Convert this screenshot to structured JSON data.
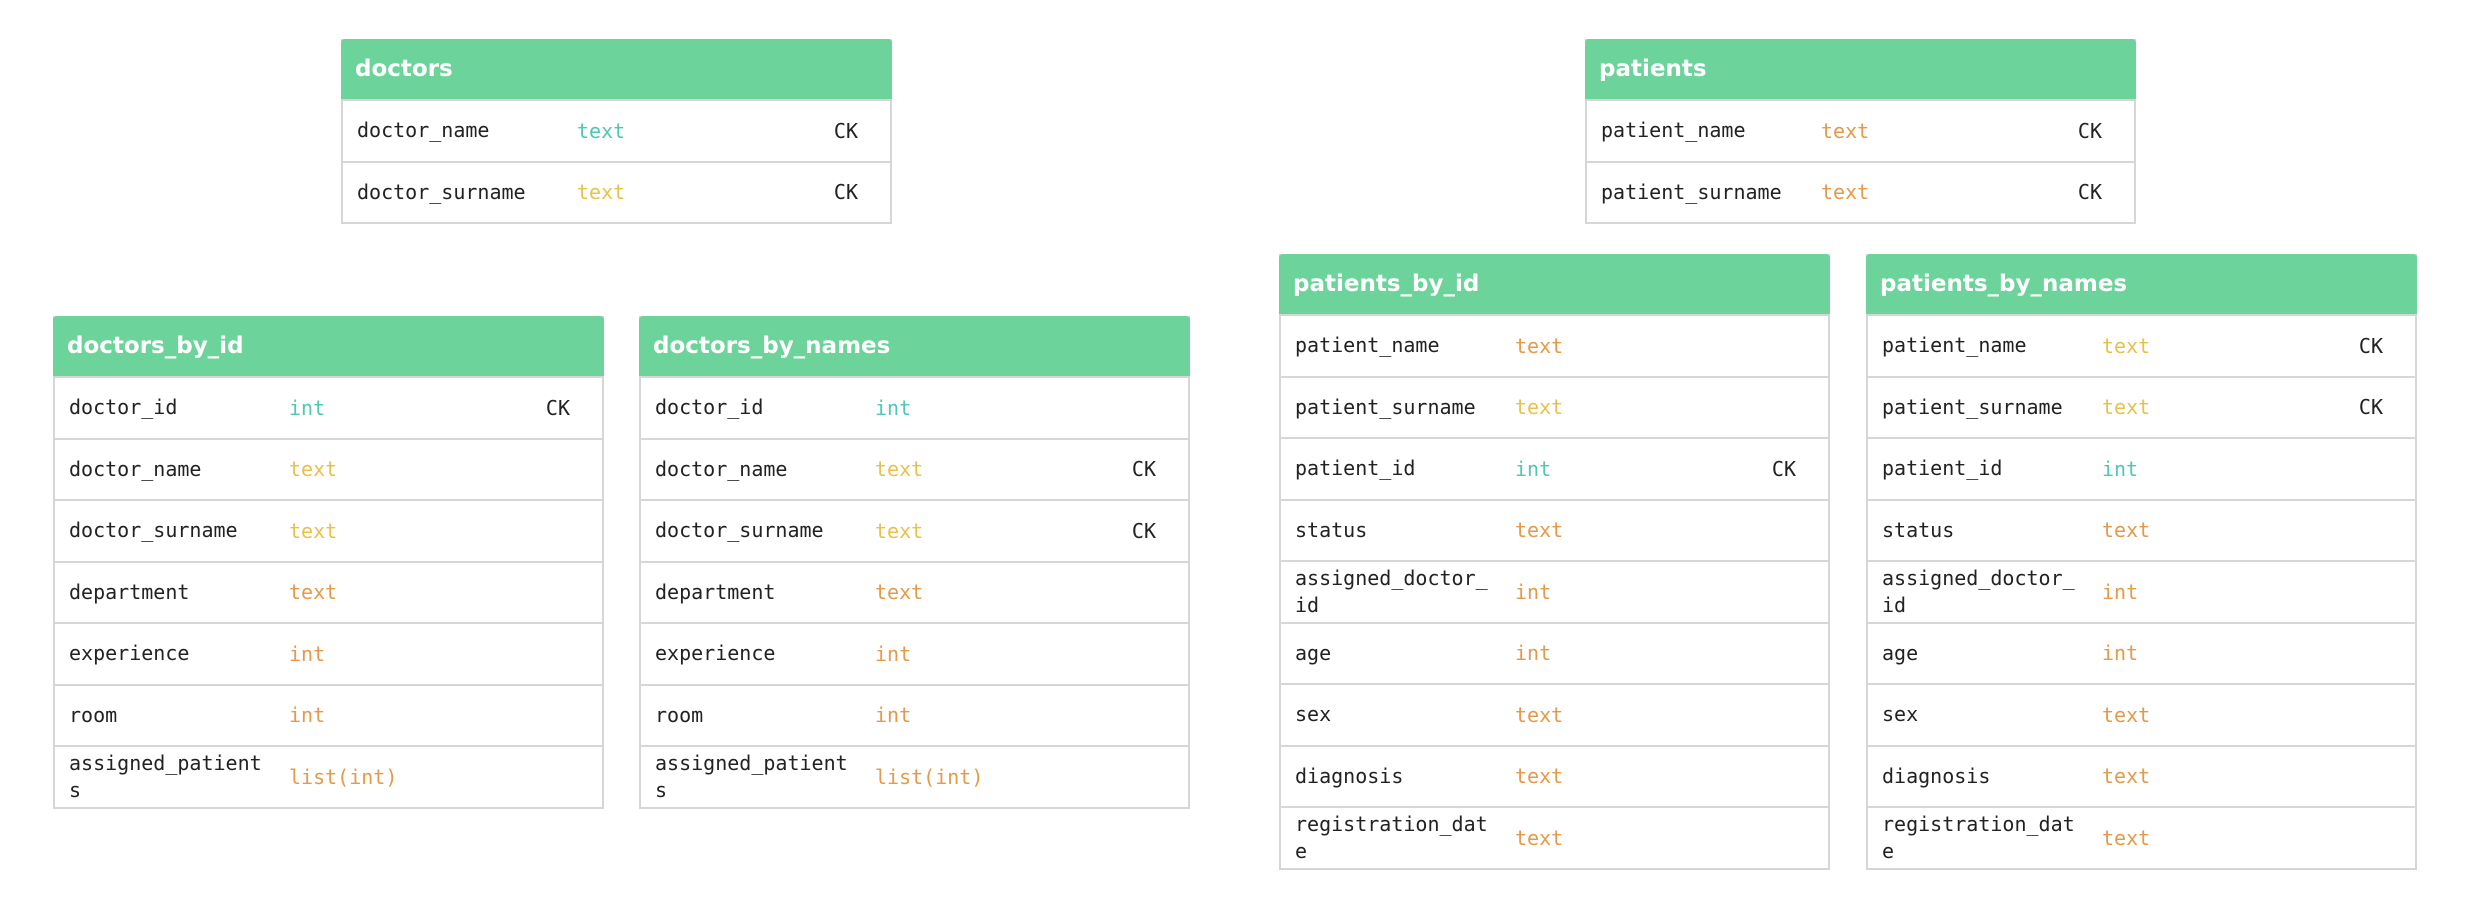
{
  "colors": {
    "header": "#6cd49a",
    "teal": "#4fc7b6",
    "yellow": "#e8c14a",
    "orange": "#e59a4a",
    "border": "#d6d6d6"
  },
  "tables": [
    {
      "id": "doctors",
      "title": "doctors",
      "rows": [
        {
          "name": "doctor_name",
          "type": "text",
          "color": "teal",
          "key": "CK"
        },
        {
          "name": "doctor_surname",
          "type": "text",
          "color": "yellow",
          "key": "CK"
        }
      ]
    },
    {
      "id": "patients",
      "title": "patients",
      "rows": [
        {
          "name": "patient_name",
          "type": "text",
          "color": "orange",
          "key": "CK"
        },
        {
          "name": "patient_surname",
          "type": "text",
          "color": "orange",
          "key": "CK"
        }
      ]
    },
    {
      "id": "doctors_by_id",
      "title": "doctors_by_id",
      "rows": [
        {
          "name": "doctor_id",
          "type": "int",
          "color": "teal",
          "key": "CK"
        },
        {
          "name": "doctor_name",
          "type": "text",
          "color": "yellow",
          "key": ""
        },
        {
          "name": "doctor_surname",
          "type": "text",
          "color": "yellow",
          "key": ""
        },
        {
          "name": "department",
          "type": "text",
          "color": "orange",
          "key": ""
        },
        {
          "name": "experience",
          "type": "int",
          "color": "orange",
          "key": ""
        },
        {
          "name": "room",
          "type": "int",
          "color": "orange",
          "key": ""
        },
        {
          "name": "assigned_patients",
          "type": "list(int)",
          "color": "orange",
          "key": ""
        }
      ]
    },
    {
      "id": "doctors_by_names",
      "title": "doctors_by_names",
      "rows": [
        {
          "name": "doctor_id",
          "type": "int",
          "color": "teal",
          "key": ""
        },
        {
          "name": "doctor_name",
          "type": "text",
          "color": "yellow",
          "key": "CK"
        },
        {
          "name": "doctor_surname",
          "type": "text",
          "color": "yellow",
          "key": "CK"
        },
        {
          "name": "department",
          "type": "text",
          "color": "orange",
          "key": ""
        },
        {
          "name": "experience",
          "type": "int",
          "color": "orange",
          "key": ""
        },
        {
          "name": "room",
          "type": "int",
          "color": "orange",
          "key": ""
        },
        {
          "name": "assigned_patients",
          "type": "list(int)",
          "color": "orange",
          "key": ""
        }
      ]
    },
    {
      "id": "patients_by_id",
      "title": "patients_by_id",
      "rows": [
        {
          "name": "patient_name",
          "type": "text",
          "color": "orange",
          "key": ""
        },
        {
          "name": "patient_surname",
          "type": "text",
          "color": "yellow",
          "key": ""
        },
        {
          "name": "patient_id",
          "type": "int",
          "color": "teal",
          "key": "CK"
        },
        {
          "name": "status",
          "type": "text",
          "color": "orange",
          "key": ""
        },
        {
          "name": "assigned_doctor_id",
          "type": "int",
          "color": "orange",
          "key": ""
        },
        {
          "name": "age",
          "type": "int",
          "color": "orange",
          "key": ""
        },
        {
          "name": "sex",
          "type": "text",
          "color": "orange",
          "key": ""
        },
        {
          "name": "diagnosis",
          "type": "text",
          "color": "orange",
          "key": ""
        },
        {
          "name": "registration_date",
          "type": "text",
          "color": "orange",
          "key": ""
        }
      ]
    },
    {
      "id": "patients_by_names",
      "title": "patients_by_names",
      "rows": [
        {
          "name": "patient_name",
          "type": "text",
          "color": "yellow",
          "key": "CK"
        },
        {
          "name": "patient_surname",
          "type": "text",
          "color": "yellow",
          "key": "CK"
        },
        {
          "name": "patient_id",
          "type": "int",
          "color": "teal",
          "key": ""
        },
        {
          "name": "status",
          "type": "text",
          "color": "orange",
          "key": ""
        },
        {
          "name": "assigned_doctor_id",
          "type": "int",
          "color": "orange",
          "key": ""
        },
        {
          "name": "age",
          "type": "int",
          "color": "orange",
          "key": ""
        },
        {
          "name": "sex",
          "type": "text",
          "color": "orange",
          "key": ""
        },
        {
          "name": "diagnosis",
          "type": "text",
          "color": "orange",
          "key": ""
        },
        {
          "name": "registration_date",
          "type": "text",
          "color": "orange",
          "key": ""
        }
      ]
    }
  ]
}
